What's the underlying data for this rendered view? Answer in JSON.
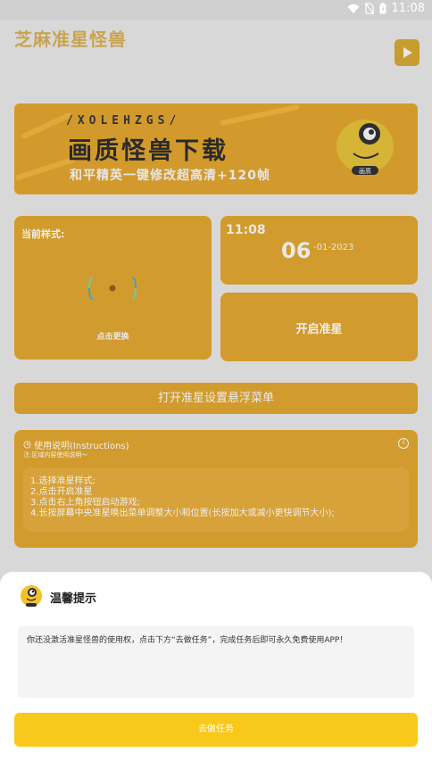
{
  "statusbar": {
    "time": "11:08"
  },
  "app": {
    "title": "芝麻准星怪兽"
  },
  "banner": {
    "tag": "/XOLEHZGS/",
    "headline": "画质怪兽下载",
    "subline": "和平精英一键修改超高清+120帧",
    "mascot_label": "画质"
  },
  "style_card": {
    "label": "当前样式:",
    "change_label": "点击更换"
  },
  "time_card": {
    "time": "11:08",
    "day": "06",
    "month_year": "-01-2023"
  },
  "aim_card": {
    "label": "开启准星"
  },
  "menu_button": {
    "label": "打开准星设置悬浮菜单"
  },
  "help": {
    "title": "使用说明(Instructions)",
    "note": "注:区域内容使用说明～",
    "steps": [
      "1.选择准星样式;",
      "2.点击开启准星",
      "3.点击右上角按钮启动游戏;",
      "4.长按屏幕中央准星唤出菜单调整大小和位置(长按加大或减小更快调节大小);"
    ]
  },
  "dialog": {
    "title": "温馨提示",
    "message": "你还没激活准星怪兽的使用权，点击下方“去做任务”，完成任务后即可永久免费使用APP！",
    "action": "去做任务"
  },
  "colors": {
    "accent": "#f8c81a",
    "card": "#d29b2d",
    "overlay_title": "#c8a451"
  }
}
